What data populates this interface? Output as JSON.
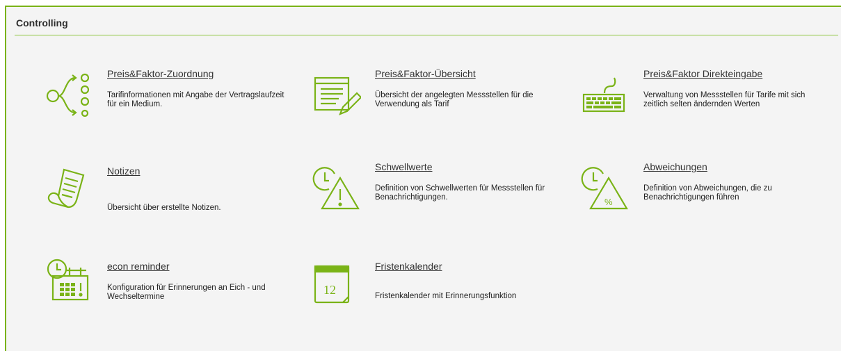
{
  "panel": {
    "title": "Controlling"
  },
  "accent": "#7ab317",
  "tiles": [
    {
      "icon": "flow-assignment-icon",
      "title": "Preis&Faktor-Zuordnung",
      "desc": "Tarifinformationen mit Angabe der Vertragslaufzeit für ein Medium."
    },
    {
      "icon": "document-edit-icon",
      "title": "Preis&Faktor-Übersicht",
      "desc": "Übersicht der angelegten Messstellen für die Verwendung als Tarif"
    },
    {
      "icon": "keyboard-icon",
      "title": "Preis&Faktor Direkteingabe",
      "desc": "Verwaltung von Messstellen für Tarife mit sich zeitlich selten ändernden Werten"
    },
    {
      "icon": "notes-icon",
      "title": "Notizen",
      "desc": "Übersicht über erstellte Notizen."
    },
    {
      "icon": "clock-warning-icon",
      "title": "Schwellwerte",
      "desc": "Definition von Schwellwerten für Messstellen für Benachrichtigungen."
    },
    {
      "icon": "clock-percent-icon",
      "title": "Abweichungen",
      "desc": "Definition von Abweichungen, die zu Benachrichtigungen führen"
    },
    {
      "icon": "reminder-calendar-icon",
      "title": "econ reminder",
      "desc": "Konfiguration für Erinnerungen an Eich - und Wechseltermine"
    },
    {
      "icon": "calendar-icon",
      "title": "Fristenkalender",
      "desc": "Fristenkalender mit Erinnerungsfunktion",
      "calendar_day": "12"
    }
  ]
}
